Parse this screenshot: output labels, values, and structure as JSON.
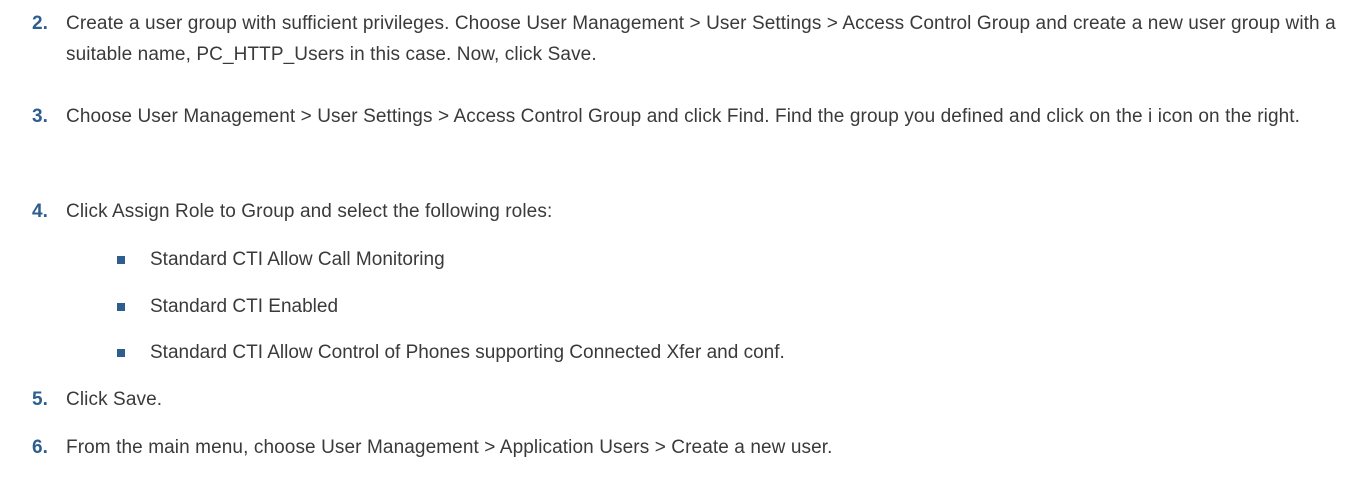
{
  "colors": {
    "accent": "#2e5e8e",
    "text": "#3a3a3a"
  },
  "steps": [
    {
      "number": "2.",
      "text": "Create a user group with sufficient privileges. Choose User Management > User Settings > Access Control Group and create a new user group with a suitable name, PC_HTTP_Users in this case. Now, click Save."
    },
    {
      "number": "3.",
      "text": "Choose User Management > User Settings > Access Control Group and click Find. Find the group you defined and click on the i icon on the right."
    },
    {
      "number": "4.",
      "text": "Click Assign Role to Group and select the following roles:"
    },
    {
      "number": "5.",
      "text": "Click Save."
    },
    {
      "number": "6.",
      "text": "From the main menu, choose User Management > Application Users > Create a new user."
    }
  ],
  "roles": [
    "Standard CTI Allow Call Monitoring",
    "Standard CTI Enabled",
    "Standard CTI Allow Control of Phones supporting Connected Xfer and conf."
  ]
}
